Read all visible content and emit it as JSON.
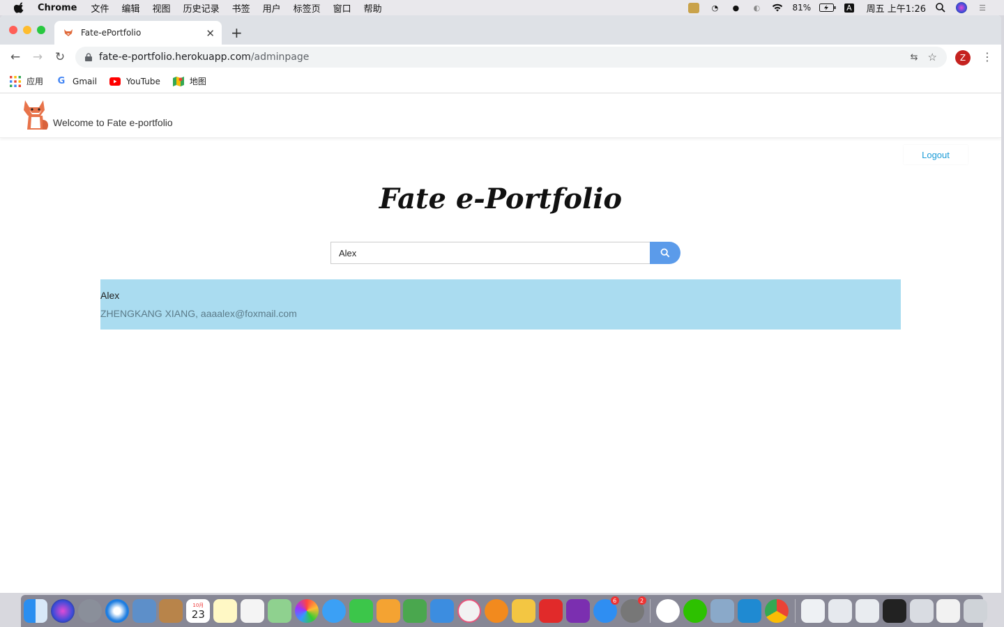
{
  "menubar": {
    "app_name": "Chrome",
    "items": [
      "文件",
      "编辑",
      "视图",
      "历史记录",
      "书签",
      "用户",
      "标签页",
      "窗口",
      "帮助"
    ],
    "battery": "81%",
    "input_method": "A",
    "clock": "周五 上午1:26"
  },
  "browser": {
    "tab_title": "Fate-ePortfolio",
    "url_host": "fate-e-portfolio.herokuapp.com",
    "url_path": "/adminpage",
    "profile_initial": "Z",
    "bookmarks": [
      {
        "label": "应用",
        "icon": "apps-grid-icon"
      },
      {
        "label": "Gmail",
        "icon": "google-icon"
      },
      {
        "label": "YouTube",
        "icon": "youtube-icon"
      },
      {
        "label": "地图",
        "icon": "maps-icon"
      }
    ]
  },
  "site": {
    "welcome": "Welcome to Fate e-portfolio",
    "logout_label": "Logout",
    "title": "Fate e-Portfolio",
    "search": {
      "value": "Alex"
    },
    "result": {
      "name": "Alex",
      "detail": "ZHENGKANG XIANG, aaaalex@foxmail.com"
    }
  },
  "dock": {
    "calendar_date": "23",
    "calendar_month": "10月",
    "appstore_badge": "6",
    "settings_badge": "2"
  },
  "colors": {
    "accent_blue": "#5b9bea",
    "result_bg": "#aadcf0",
    "logout_text": "#1a9bd7"
  }
}
